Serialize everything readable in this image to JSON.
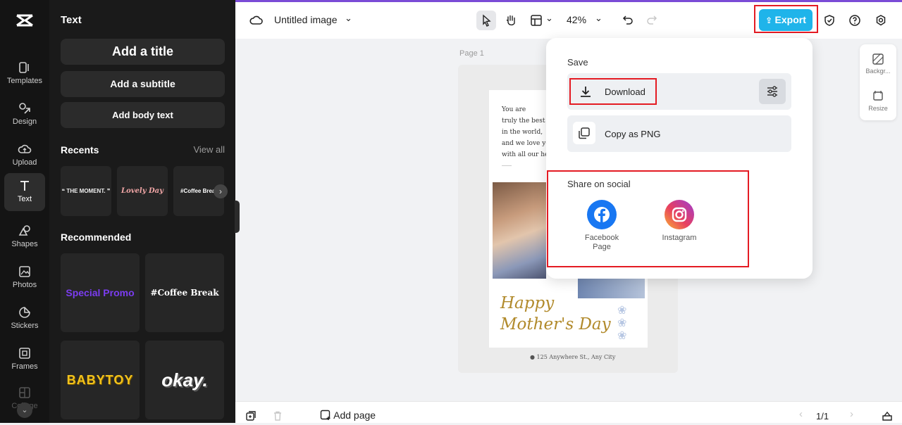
{
  "rail": {
    "items": [
      {
        "label": "Templates",
        "icon": "templates-icon"
      },
      {
        "label": "Design",
        "icon": "design-icon"
      },
      {
        "label": "Upload",
        "icon": "upload-icon"
      },
      {
        "label": "Text",
        "icon": "text-icon",
        "active": true
      },
      {
        "label": "Shapes",
        "icon": "shapes-icon"
      },
      {
        "label": "Photos",
        "icon": "photos-icon"
      },
      {
        "label": "Stickers",
        "icon": "stickers-icon"
      },
      {
        "label": "Frames",
        "icon": "frames-icon"
      },
      {
        "label": "Collage",
        "icon": "collage-icon"
      }
    ]
  },
  "panel": {
    "title": "Text",
    "add_title": "Add a title",
    "add_subtitle": "Add a subtitle",
    "add_body": "Add body text",
    "recents_title": "Recents",
    "view_all": "View all",
    "recents": [
      "❝ THE MOMENT. ❞",
      "Lovely Day",
      "#Coffee Break"
    ],
    "recommended_title": "Recommended",
    "recommended": [
      "Special Promo",
      "#Coffee Break",
      "BABYTOY",
      "okay."
    ]
  },
  "topbar": {
    "doc_title": "Untitled image",
    "zoom": "42%",
    "export_label": "Export"
  },
  "canvas": {
    "page_label": "Page 1",
    "poem": "You are\ntruly the best\nin the world,\nand we love yo\nwith all our he",
    "happy": "Happy\nMother's Day",
    "address": "125 Anywhere St., Any City"
  },
  "mini_panel": {
    "background": "Backgr...",
    "resize": "Resize"
  },
  "export_menu": {
    "save_label": "Save",
    "download": "Download",
    "copy_png": "Copy as PNG",
    "share_label": "Share on social",
    "facebook": "Facebook Page",
    "instagram": "Instagram"
  },
  "bottombar": {
    "add_page": "Add page",
    "page_count": "1/1"
  },
  "colors": {
    "accent": "#1fb4ea",
    "highlight": "#e41b23",
    "facebook": "#1877f2"
  }
}
